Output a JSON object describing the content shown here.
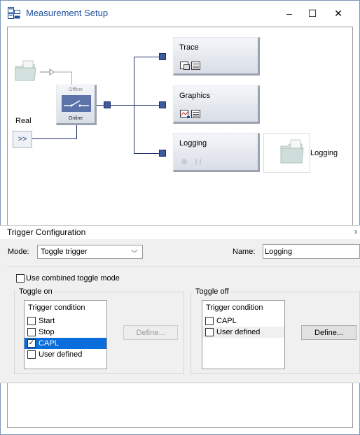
{
  "window": {
    "title": "Measurement Setup",
    "minimize": "–",
    "maximize": "☐",
    "close": "✕"
  },
  "canvas": {
    "switch_block": {
      "offline_label": "Offline",
      "online_label": "Online"
    },
    "real_label": "Real",
    "real_button": ">>",
    "trace_block": {
      "label": "Trace"
    },
    "graphics_block": {
      "label": "Graphics"
    },
    "logging_block": {
      "label": "Logging"
    },
    "logging_file_label": "Logging"
  },
  "trigger": {
    "title": "Trigger Configuration",
    "mode_label": "Mode:",
    "mode_value": "Toggle trigger",
    "name_label": "Name:",
    "name_value": "Logging",
    "combined_label": "Use combined toggle mode",
    "toggle_on": {
      "title": "Toggle on",
      "header": "Trigger condition",
      "items": [
        {
          "label": "Start",
          "checked": false,
          "selected": false
        },
        {
          "label": "Stop",
          "checked": false,
          "selected": false
        },
        {
          "label": "CAPL",
          "checked": true,
          "selected": true
        },
        {
          "label": "User defined",
          "checked": false,
          "selected": false
        }
      ],
      "define_label": "Define..."
    },
    "toggle_off": {
      "title": "Toggle off",
      "header": "Trigger condition",
      "items": [
        {
          "label": "CAPL",
          "checked": false
        },
        {
          "label": "User defined",
          "checked": false
        }
      ],
      "define_label": "Define..."
    }
  },
  "colors": {
    "accent": "#1e4f9c",
    "selection": "#0a6ddc",
    "connector": "#22306a"
  }
}
